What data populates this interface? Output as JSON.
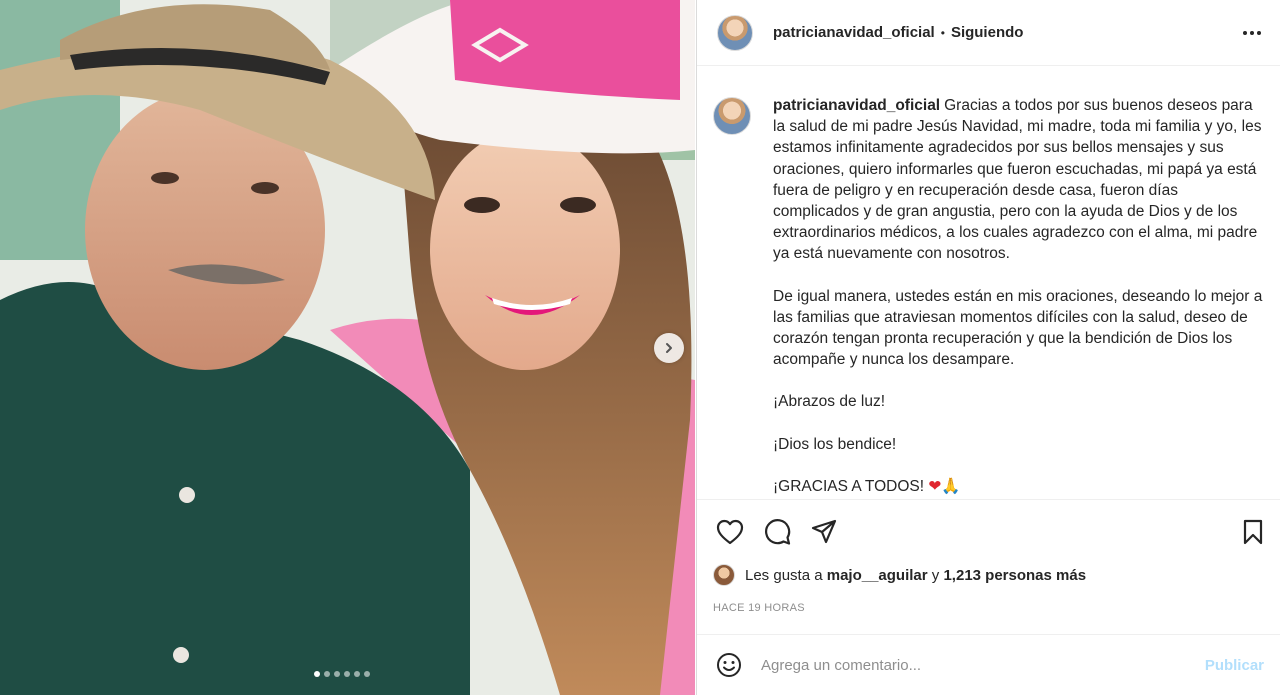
{
  "post": {
    "username": "patricianavidad_oficial",
    "separator": "•",
    "follow_status": "Siguiendo",
    "more_icon": "more-dots-icon",
    "caption_paragraphs": [
      "Gracias a todos por sus buenos deseos para la salud de mi padre Jesús Navidad, mi madre, toda mi familia y yo, les estamos infinitamente agradecidos por sus bellos mensajes y sus oraciones, quiero informarles que fueron escuchadas, mi papá ya está fuera de peligro y en recuperación desde casa, fueron días complicados y de gran angustia, pero con la ayuda de Dios y de los extraordinarios médicos, a los cuales agradezco con el alma, mi padre ya está nuevamente con nosotros.",
      "De igual manera, ustedes están en mis oraciones, deseando lo mejor a las familias que atraviesan momentos difíciles con la salud, deseo de corazón tengan pronta recuperación y que la bendición de Dios los acompañe y nunca los desampare.",
      "¡Abrazos de luz!",
      "¡Dios los bendice!",
      "¡GRACIAS A TODOS!"
    ],
    "caption_emojis": "❤🙏",
    "likes_prefix": "Les gusta a",
    "likes_user": "majo__aguilar",
    "likes_connector": "y",
    "likes_rest": "1,213 personas más",
    "timestamp": "HACE 19 HORAS",
    "comment_placeholder": "Agrega un comentario...",
    "publish_label": "Publicar",
    "carousel": {
      "total": 6,
      "active_index": 0
    }
  },
  "colors": {
    "link_blue_disabled": "#b2dffc",
    "muted_text": "#8e8e8e",
    "border": "#dbdbdb"
  }
}
